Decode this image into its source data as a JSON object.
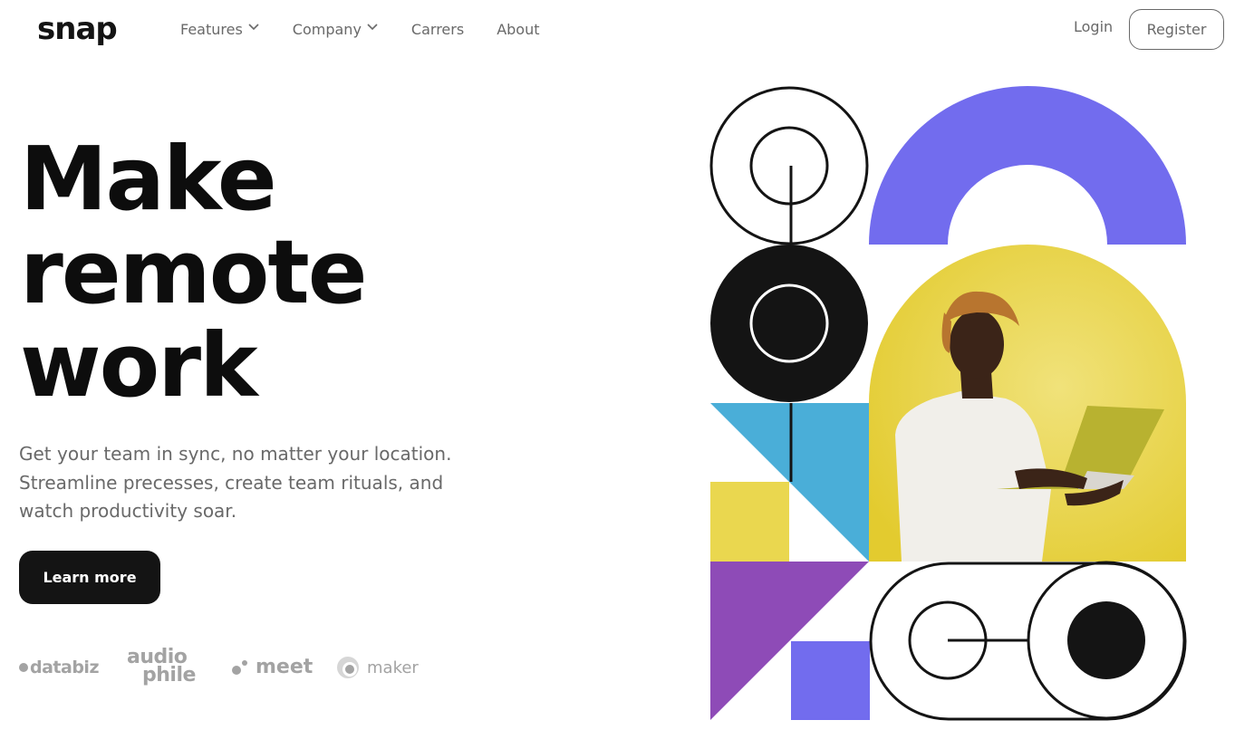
{
  "header": {
    "logo": "snap",
    "nav": [
      {
        "label": "Features",
        "has_dropdown": true
      },
      {
        "label": "Company",
        "has_dropdown": true
      },
      {
        "label": "Carrers",
        "has_dropdown": false
      },
      {
        "label": "About",
        "has_dropdown": false
      }
    ],
    "login_label": "Login",
    "register_label": "Register"
  },
  "hero": {
    "headline_lines": [
      "Make",
      "remote",
      "work"
    ],
    "subcopy": "Get your team in sync, no matter your location. Streamline precesses, create team rituals, and watch productivity soar.",
    "cta_label": "Learn more"
  },
  "clients": {
    "databiz": "databiz",
    "audiophile_top": "audio",
    "audiophile_bottom": "phile",
    "meet": "meet",
    "maker": "maker"
  },
  "colors": {
    "text_dark": "#141414",
    "text_gray": "#696969",
    "logo_gray": "#a3a3a3",
    "purple": "#726cee",
    "yellow": "#ead74f",
    "blue": "#4aaed8",
    "violet": "#8e4bb7"
  }
}
